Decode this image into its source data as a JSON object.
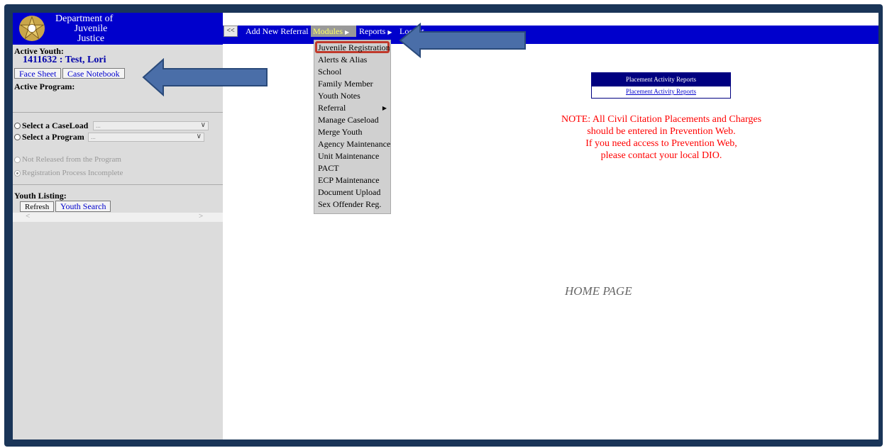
{
  "header": {
    "department_line1": "Department of",
    "department_line2": "Juvenile",
    "department_line3": "Justice"
  },
  "sidebar": {
    "active_youth_label": "Active Youth:",
    "youth_id_name": "1411632 : Test, Lori",
    "face_sheet_button": "Face Sheet",
    "case_notebook_button": "Case Notebook",
    "active_program_label": "Active Program:",
    "select_caseload_label": "Select a CaseLoad",
    "select_program_label": "Select a Program",
    "caseload_select_value": "...",
    "program_select_value": "...",
    "not_released_label": "Not Released from the Program",
    "registration_incomplete_label": "Registration Process Incomplete",
    "youth_listing_label": "Youth Listing:",
    "refresh_button": "Refresh",
    "youth_search_button": "Youth Search"
  },
  "topbar": {
    "collapse_label": "<<",
    "add_new_referral": "Add New Referral",
    "modules": "Modules",
    "reports": "Reports",
    "logout": "Logout"
  },
  "dropdown": {
    "items": [
      "Juvenile Registration",
      "Alerts & Alias",
      "School",
      "Family Member",
      "Youth Notes",
      "Referral",
      "Manage Caseload",
      "Merge Youth",
      "Agency Maintenance",
      "Unit Maintenance",
      "PACT",
      "ECP Maintenance",
      "Document Upload",
      "Sex Offender Reg."
    ]
  },
  "main": {
    "placement_header": "Placement Activity Reports",
    "placement_link": "Placement Activity Reports",
    "note_line1": "NOTE: All Civil Citation Placements and Charges",
    "note_line2": "should be entered in Prevention Web.",
    "note_line3": "If you need access to Prevention Web,",
    "note_line4": "please contact your local DIO.",
    "home_page": "HOME PAGE"
  },
  "colors": {
    "frame": "#1a3558",
    "nav_blue": "#0000cc",
    "sidebar_gray": "#dcdcdc",
    "note_red": "#ff0000",
    "highlight_red": "#c0392b",
    "arrow_blue": "#4a6ea8"
  }
}
